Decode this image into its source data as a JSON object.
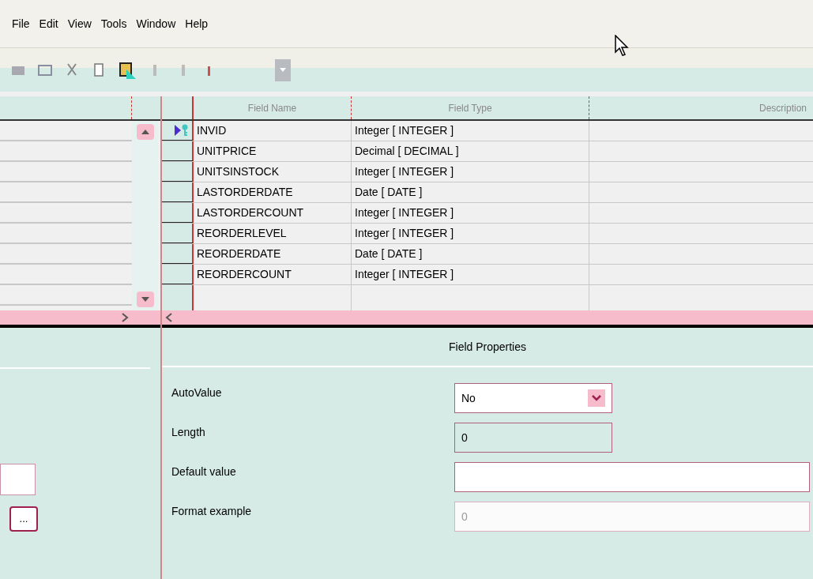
{
  "menu": [
    {
      "label": "File"
    },
    {
      "label": "Edit"
    },
    {
      "label": "View"
    },
    {
      "label": "Tools"
    },
    {
      "label": "Window"
    },
    {
      "label": "Help"
    }
  ],
  "table": {
    "columns": [
      "Field Name",
      "Field Type",
      "Description"
    ],
    "rows": [
      {
        "name": "INVID",
        "type": "Integer [ INTEGER ]",
        "selected": true,
        "primary_key": true
      },
      {
        "name": "UNITPRICE",
        "type": "Decimal [ DECIMAL ]",
        "selected": false,
        "primary_key": false
      },
      {
        "name": "UNITSINSTOCK",
        "type": "Integer [ INTEGER ]",
        "selected": false,
        "primary_key": false
      },
      {
        "name": "LASTORDERDATE",
        "type": "Date [ DATE ]",
        "selected": false,
        "primary_key": false
      },
      {
        "name": "LASTORDERCOUNT",
        "type": "Integer [ INTEGER ]",
        "selected": false,
        "primary_key": false
      },
      {
        "name": "REORDERLEVEL",
        "type": "Integer [ INTEGER ]",
        "selected": false,
        "primary_key": false
      },
      {
        "name": "REORDERDATE",
        "type": "Date [ DATE ]",
        "selected": false,
        "primary_key": false
      },
      {
        "name": "REORDERCOUNT",
        "type": "Integer [ INTEGER ]",
        "selected": false,
        "primary_key": false
      }
    ]
  },
  "left_panel": {
    "button": "..."
  },
  "properties": {
    "title": "Field Properties",
    "fields": [
      {
        "label": "AutoValue",
        "kind": "dropdown",
        "value": "No",
        "disabled": false
      },
      {
        "label": "Length",
        "kind": "spin",
        "value": "0",
        "disabled": false
      },
      {
        "label": "Default value",
        "kind": "text",
        "disabled": false
      },
      {
        "label": "Format example",
        "kind": "text",
        "value": "0",
        "disabled": true
      }
    ]
  }
}
